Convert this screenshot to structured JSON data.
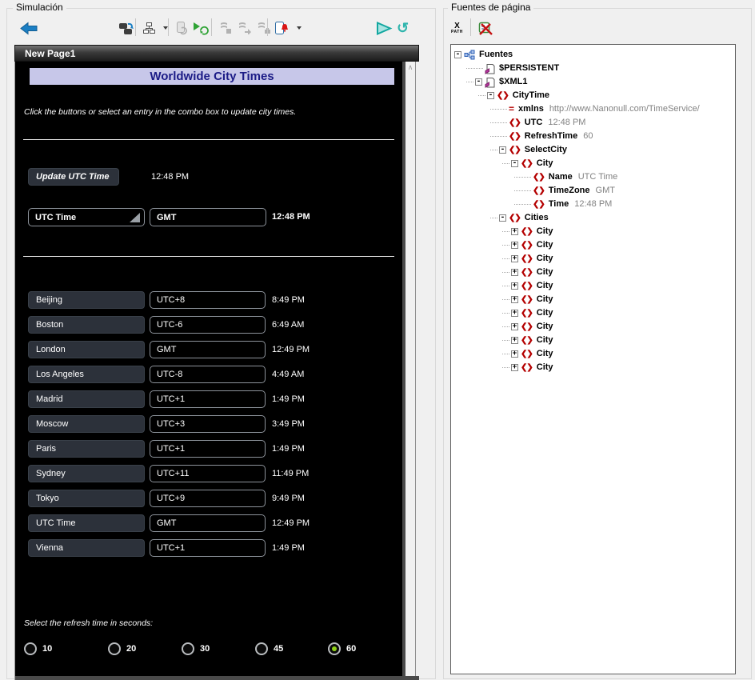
{
  "left_panel": {
    "title": "Simulación",
    "page_tab": "New Page1",
    "toolbar_icons": [
      "back",
      "restart-simulation",
      "page-hierarchy-dropdown",
      "reload-page",
      "play-refresh",
      "step-into",
      "step-over",
      "step-out",
      "device-alerts-dropdown",
      "run",
      "reset"
    ],
    "phone": {
      "title": "Worldwide City Times",
      "instruction": "Click the buttons or select an entry in the combo box to update city times.",
      "update_button": "Update UTC Time",
      "top_time": "12:48 PM",
      "combo": {
        "label": "UTC Time",
        "zone": "GMT",
        "time": "12:48 PM"
      },
      "cities": [
        {
          "name": "Beijing",
          "zone": "UTC+8",
          "time": "8:49 PM"
        },
        {
          "name": "Boston",
          "zone": "UTC-6",
          "time": "6:49 AM"
        },
        {
          "name": "London",
          "zone": "GMT",
          "time": "12:49 PM"
        },
        {
          "name": "Los Angeles",
          "zone": "UTC-8",
          "time": "4:49 AM"
        },
        {
          "name": "Madrid",
          "zone": "UTC+1",
          "time": "1:49 PM"
        },
        {
          "name": "Moscow",
          "zone": "UTC+3",
          "time": "3:49 PM"
        },
        {
          "name": "Paris",
          "zone": "UTC+1",
          "time": "1:49 PM"
        },
        {
          "name": "Sydney",
          "zone": "UTC+11",
          "time": "11:49 PM"
        },
        {
          "name": "Tokyo",
          "zone": "UTC+9",
          "time": "9:49 PM"
        },
        {
          "name": "UTC Time",
          "zone": "GMT",
          "time": "12:49 PM"
        },
        {
          "name": "Vienna",
          "zone": "UTC+1",
          "time": "1:49 PM"
        }
      ],
      "refresh_label": "Select the refresh time in seconds:",
      "refresh_options": [
        "10",
        "20",
        "30",
        "45",
        "60"
      ],
      "refresh_selected": "60"
    }
  },
  "right_panel": {
    "title": "Fuentes de página",
    "toolbar_icons": [
      "xpath",
      "remove-source"
    ],
    "tree": [
      {
        "level": 0,
        "expand": "minus",
        "icon": "root",
        "name": "Fuentes",
        "value": ""
      },
      {
        "level": 1,
        "expand": "none",
        "icon": "page",
        "name": "$PERSISTENT",
        "value": ""
      },
      {
        "level": 1,
        "expand": "minus",
        "icon": "page",
        "name": "$XML1",
        "value": ""
      },
      {
        "level": 2,
        "expand": "minus",
        "icon": "element",
        "name": "CityTime",
        "value": ""
      },
      {
        "level": 3,
        "expand": "none",
        "icon": "attribute",
        "name": "xmlns",
        "value": "http://www.Nanonull.com/TimeService/"
      },
      {
        "level": 3,
        "expand": "none",
        "icon": "element",
        "name": "UTC",
        "value": "12:48 PM"
      },
      {
        "level": 3,
        "expand": "none",
        "icon": "element",
        "name": "RefreshTime",
        "value": "60"
      },
      {
        "level": 3,
        "expand": "minus",
        "icon": "element",
        "name": "SelectCity",
        "value": ""
      },
      {
        "level": 4,
        "expand": "minus",
        "icon": "element",
        "name": "City",
        "value": ""
      },
      {
        "level": 5,
        "expand": "none",
        "icon": "element",
        "name": "Name",
        "value": "UTC Time"
      },
      {
        "level": 5,
        "expand": "none",
        "icon": "element",
        "name": "TimeZone",
        "value": "GMT"
      },
      {
        "level": 5,
        "expand": "none",
        "icon": "element",
        "name": "Time",
        "value": "12:48 PM"
      },
      {
        "level": 3,
        "expand": "minus",
        "icon": "element",
        "name": "Cities",
        "value": ""
      },
      {
        "level": 4,
        "expand": "plus",
        "icon": "element",
        "name": "City",
        "value": ""
      },
      {
        "level": 4,
        "expand": "plus",
        "icon": "element",
        "name": "City",
        "value": ""
      },
      {
        "level": 4,
        "expand": "plus",
        "icon": "element",
        "name": "City",
        "value": ""
      },
      {
        "level": 4,
        "expand": "plus",
        "icon": "element",
        "name": "City",
        "value": ""
      },
      {
        "level": 4,
        "expand": "plus",
        "icon": "element",
        "name": "City",
        "value": ""
      },
      {
        "level": 4,
        "expand": "plus",
        "icon": "element",
        "name": "City",
        "value": ""
      },
      {
        "level": 4,
        "expand": "plus",
        "icon": "element",
        "name": "City",
        "value": ""
      },
      {
        "level": 4,
        "expand": "plus",
        "icon": "element",
        "name": "City",
        "value": ""
      },
      {
        "level": 4,
        "expand": "plus",
        "icon": "element",
        "name": "City",
        "value": ""
      },
      {
        "level": 4,
        "expand": "plus",
        "icon": "element",
        "name": "City",
        "value": ""
      },
      {
        "level": 4,
        "expand": "plus",
        "icon": "element",
        "name": "City",
        "value": ""
      }
    ]
  }
}
